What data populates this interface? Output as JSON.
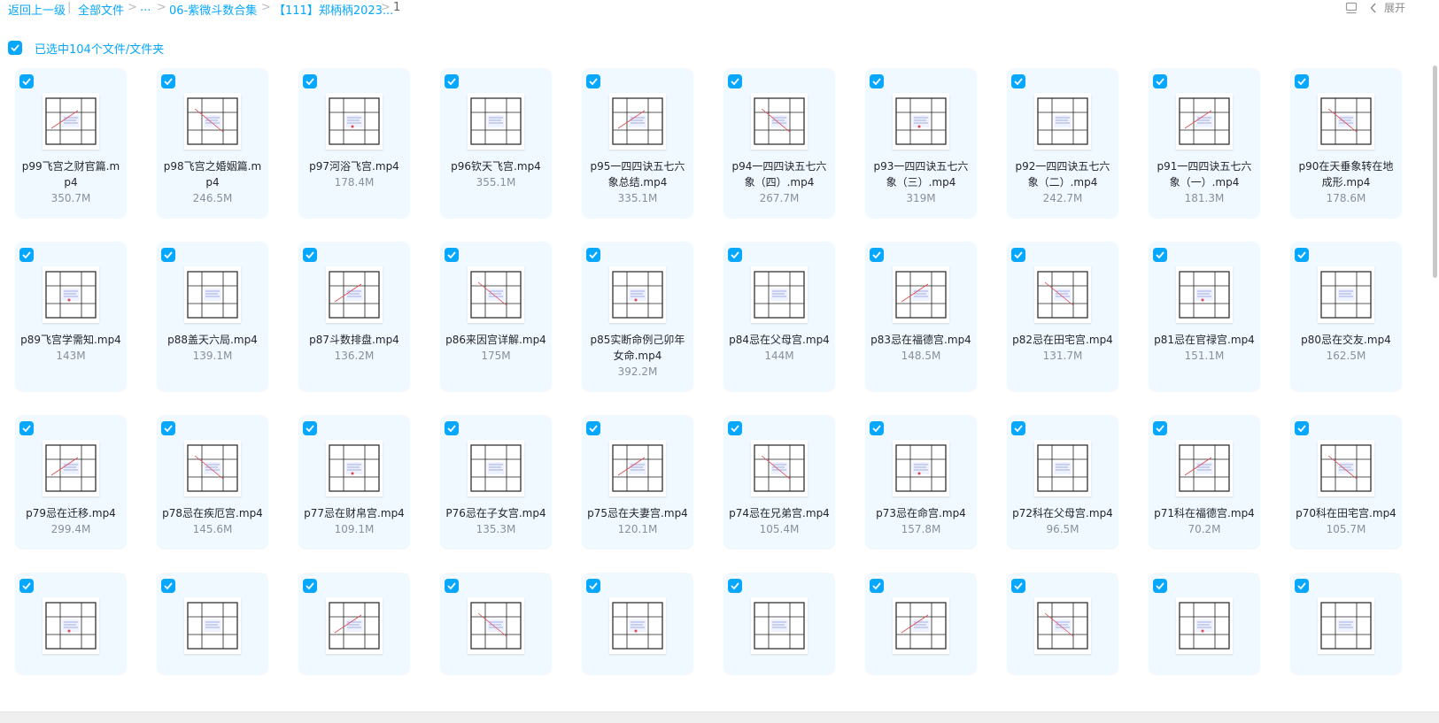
{
  "breadcrumb": {
    "back": "返回上一级",
    "all_files": "全部文件",
    "ellipsis": "...",
    "folder1": "06-紫微斗数合集",
    "folder2": "【111】郑柄柄2023...",
    "current": "1"
  },
  "toolbar": {
    "expand_label": "展开",
    "view_icon": "list-view-icon",
    "collapse_icon": "chevron-left-icon"
  },
  "selection": {
    "label": "已选中104个文件/文件夹",
    "checked": true
  },
  "colors": {
    "accent": "#06a7ff",
    "card_bg": "#f0f9ff"
  },
  "files": [
    {
      "name": "p99飞宫之财官篇.mp4",
      "size": "350.7M"
    },
    {
      "name": "p98飞宫之婚姻篇.mp4",
      "size": "246.5M"
    },
    {
      "name": "p97河浴飞宫.mp4",
      "size": "178.4M"
    },
    {
      "name": "p96钦天飞宫.mp4",
      "size": "355.1M"
    },
    {
      "name": "p95一四四诀五七六象总结.mp4",
      "size": "335.1M"
    },
    {
      "name": "p94一四四诀五七六象（四）.mp4",
      "size": "267.7M"
    },
    {
      "name": "p93一四四诀五七六象（三）.mp4",
      "size": "319M"
    },
    {
      "name": "p92一四四诀五七六象（二）.mp4",
      "size": "242.7M"
    },
    {
      "name": "p91一四四诀五七六象（一）.mp4",
      "size": "181.3M"
    },
    {
      "name": "p90在天垂象转在地成形.mp4",
      "size": "178.6M"
    },
    {
      "name": "p89飞宫学需知.mp4",
      "size": "143M"
    },
    {
      "name": "p88盖天六局.mp4",
      "size": "139.1M"
    },
    {
      "name": "p87斗数排盘.mp4",
      "size": "136.2M"
    },
    {
      "name": "p86来因宫详解.mp4",
      "size": "175M"
    },
    {
      "name": "p85实断命例己卯年女命.mp4",
      "size": "392.2M"
    },
    {
      "name": "p84忌在父母宫.mp4",
      "size": "144M"
    },
    {
      "name": "p83忌在福德宫.mp4",
      "size": "148.5M"
    },
    {
      "name": "p82忌在田宅宫.mp4",
      "size": "131.7M"
    },
    {
      "name": "p81忌在官禄宫.mp4",
      "size": "151.1M"
    },
    {
      "name": "p80忌在交友.mp4",
      "size": "162.5M"
    },
    {
      "name": "p79忌在迁移.mp4",
      "size": "299.4M"
    },
    {
      "name": "p78忌在疾厄宫.mp4",
      "size": "145.6M"
    },
    {
      "name": "p77忌在财帛宫.mp4",
      "size": "109.1M"
    },
    {
      "name": "P76忌在子女宫.mp4",
      "size": "135.3M"
    },
    {
      "name": "p75忌在夫妻宫.mp4",
      "size": "120.1M"
    },
    {
      "name": "p74忌在兄弟宫.mp4",
      "size": "105.4M"
    },
    {
      "name": "p73忌在命宫.mp4",
      "size": "157.8M"
    },
    {
      "name": "p72科在父母宫.mp4",
      "size": "96.5M"
    },
    {
      "name": "p71科在福德宫.mp4",
      "size": "70.2M"
    },
    {
      "name": "p70科在田宅宫.mp4",
      "size": "105.7M"
    },
    {
      "name": "",
      "size": ""
    },
    {
      "name": "",
      "size": ""
    },
    {
      "name": "",
      "size": ""
    },
    {
      "name": "",
      "size": ""
    },
    {
      "name": "",
      "size": ""
    },
    {
      "name": "",
      "size": ""
    },
    {
      "name": "",
      "size": ""
    },
    {
      "name": "",
      "size": ""
    },
    {
      "name": "",
      "size": ""
    },
    {
      "name": "",
      "size": ""
    }
  ]
}
